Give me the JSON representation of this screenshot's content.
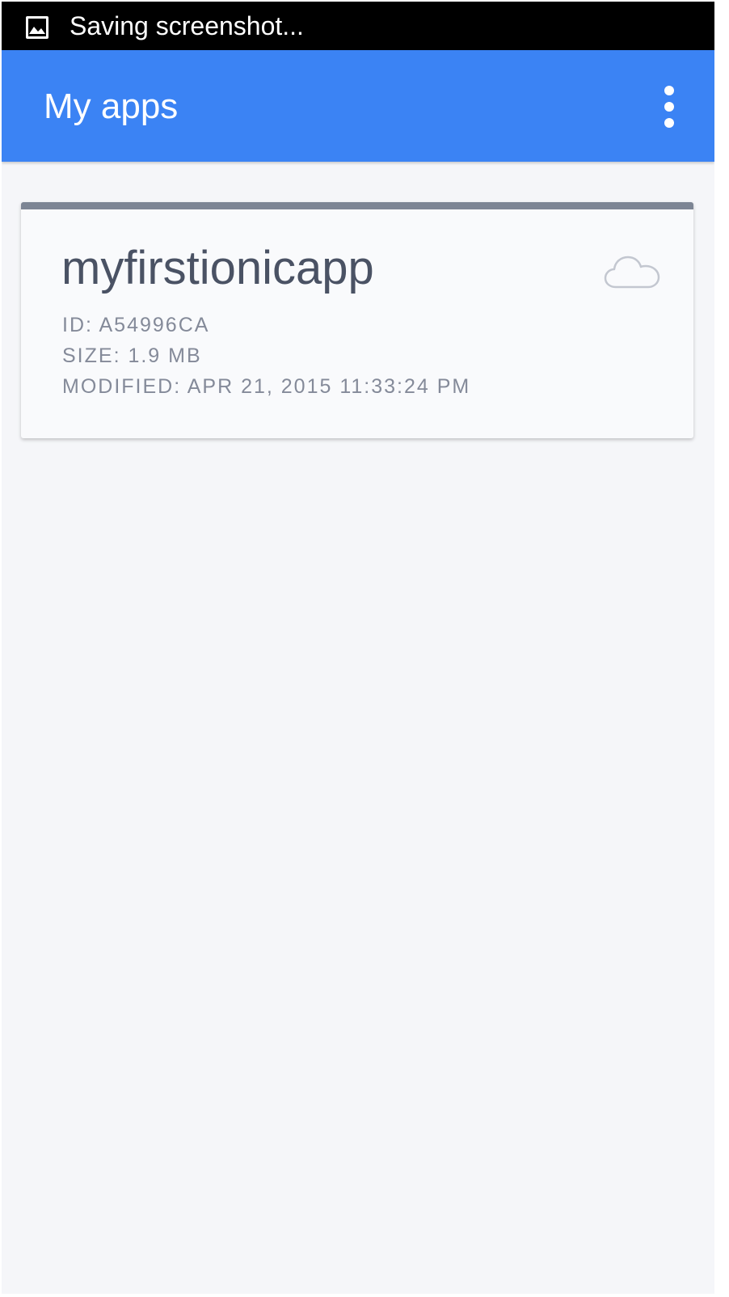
{
  "status_bar": {
    "notification_icon": "image-icon",
    "text": "Saving screenshot..."
  },
  "app_bar": {
    "title": "My apps",
    "menu_icon": "more-vert-icon",
    "color": "#3b83f4"
  },
  "apps": [
    {
      "name": "myfirstionicapp",
      "id_label": "ID: A54996CA",
      "size_label": "SIZE: 1.9 MB",
      "modified_label": "MODIFIED: APR 21, 2015 11:33:24 PM",
      "status_icon": "cloud-icon"
    }
  ]
}
